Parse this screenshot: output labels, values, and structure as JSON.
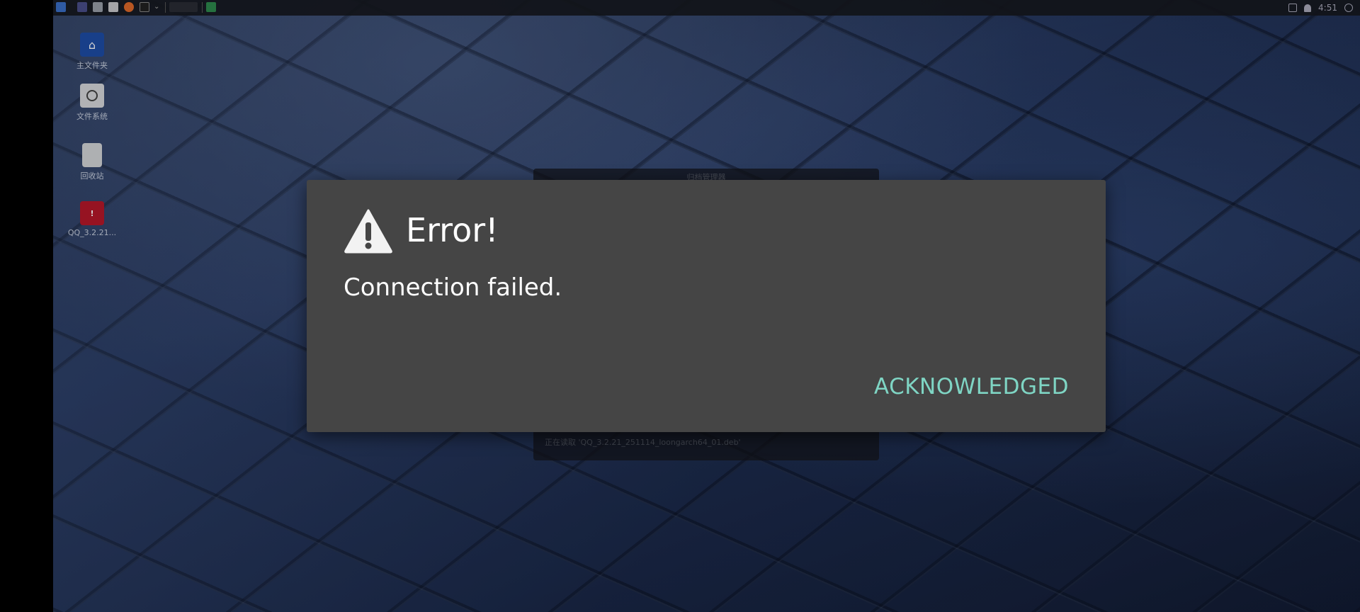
{
  "topbar": {
    "clock": "4:51"
  },
  "desktop_icons": [
    {
      "label": "主文件夹",
      "icon": "home-folder-icon"
    },
    {
      "label": "文件系统",
      "icon": "filesystem-icon"
    },
    {
      "label": "回收站",
      "icon": "trash-icon"
    },
    {
      "label": "QQ_3.2.21...",
      "icon": "qq-package-icon"
    }
  ],
  "background_window": {
    "title": "归档管理器",
    "status": "正在读取 'QQ_3.2.21_251114_loongarch64_01.deb'"
  },
  "dialog": {
    "icon": "warning-triangle-icon",
    "title": "Error!",
    "message": "Connection failed.",
    "button_label": "ACKNOWLEDGED",
    "accent_color": "#7fd5c4",
    "background_color": "#454545"
  }
}
